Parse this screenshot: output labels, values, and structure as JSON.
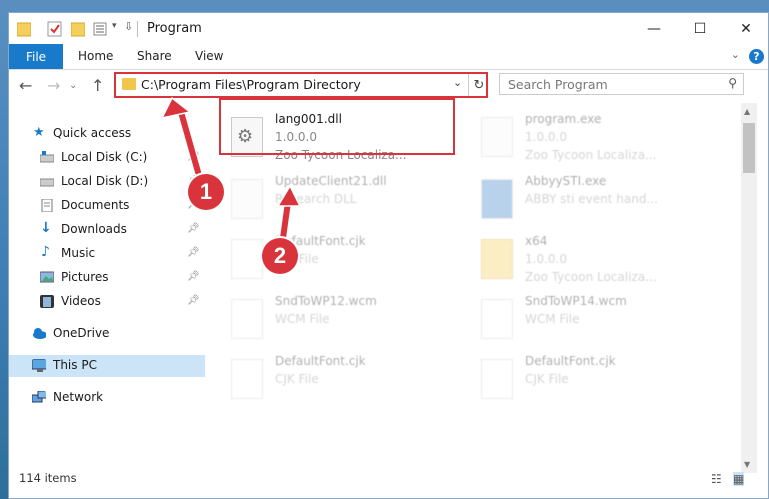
{
  "window": {
    "title": "Program"
  },
  "ribbon": {
    "tabs": [
      "File",
      "Home",
      "Share",
      "View"
    ]
  },
  "navigation": {
    "address": "C:\\Program Files\\Program Directory",
    "search_placeholder": "Search Program"
  },
  "sidebar": {
    "items": [
      {
        "label": "Quick access",
        "icon": "star-icon",
        "pinned": false
      },
      {
        "label": "Local Disk (C:)",
        "icon": "drive-icon",
        "pinned": true
      },
      {
        "label": "Local Disk (D:)",
        "icon": "drive-icon",
        "pinned": true
      },
      {
        "label": "Documents",
        "icon": "documents-icon",
        "pinned": true
      },
      {
        "label": "Downloads",
        "icon": "download-icon",
        "pinned": true
      },
      {
        "label": "Music",
        "icon": "music-icon",
        "pinned": true
      },
      {
        "label": "Pictures",
        "icon": "pictures-icon",
        "pinned": true
      },
      {
        "label": "Videos",
        "icon": "videos-icon",
        "pinned": true
      },
      {
        "label": "OneDrive",
        "icon": "cloud-icon",
        "pinned": false
      },
      {
        "label": "This PC",
        "icon": "computer-icon",
        "pinned": false,
        "selected": true
      },
      {
        "label": "Network",
        "icon": "network-icon",
        "pinned": false
      }
    ]
  },
  "files": [
    {
      "name": "lang001.dll",
      "line2": "1.0.0.0",
      "line3": "Zoo Tycoon Localiza..."
    },
    {
      "name": "program.exe",
      "line2": "1.0.0.0",
      "line3": "Zoo Tycoon Localiza..."
    },
    {
      "name": "UpdateClient21.dll",
      "line2": "Research DLL",
      "line3": ""
    },
    {
      "name": "AbbyySTI.exe",
      "line2": "ABBY sti event hand...",
      "line3": ""
    },
    {
      "name": "DefaultFont.cjk",
      "line2": "CJK File",
      "line3": ""
    },
    {
      "name": "x64",
      "line2": "1.0.0.0",
      "line3": "Zoo Tycoon Localiza..."
    },
    {
      "name": "SndToWP12.wcm",
      "line2": "WCM File",
      "line3": ""
    },
    {
      "name": "SndToWP14.wcm",
      "line2": "WCM File",
      "line3": ""
    },
    {
      "name": "DefaultFont.cjk",
      "line2": "CJK File",
      "line3": ""
    },
    {
      "name": "DefaultFont.cjk",
      "line2": "CJK File",
      "line3": ""
    }
  ],
  "status": {
    "item_count": "114 items"
  },
  "annotations": {
    "badge1": "1",
    "badge2": "2"
  },
  "colors": {
    "accent": "#1979ca",
    "annotation_red": "#d9343b",
    "selected_bg": "#cce4f7"
  }
}
